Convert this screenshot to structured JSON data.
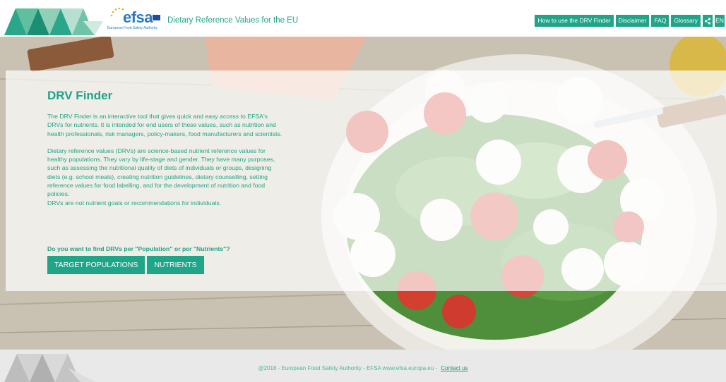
{
  "header": {
    "site_title": "Dietary Reference Values for the EU",
    "logo": {
      "name": "efsa",
      "tagline": "European Food Safety Authority"
    },
    "nav": [
      {
        "label": "How to use the DRV Finder"
      },
      {
        "label": "Disclaimer"
      },
      {
        "label": "FAQ"
      },
      {
        "label": "Glossary"
      }
    ],
    "share_icon": "share-icon",
    "language": "EN"
  },
  "main": {
    "title": "DRV Finder",
    "paragraph1": "The DRV Finder is an interactive tool that gives quick and easy access to EFSA's DRVs for nutrients. It is intended for end users of these values, such as nutrition and health professionals, risk managers, policy-makers, food manufacturers and scientists.",
    "paragraph2": "Dietary reference values (DRVs) are science-based nutrient reference values for healthy populations. They vary by life-stage and gender. They have many purposes, such as assessing the nutritional quality of diets of individuals or groups, designing diets (e.g. school meals), creating nutrition guidelines, dietary counselling, setting reference values for food labelling, and for the development of nutrition and food policies.",
    "note": "DRVs are not nutrient goals or recommendations for individuals.",
    "question": "Do you want to find DRVs per \"Population\" or per \"Nutrients\"?",
    "buttons": {
      "populations": "TARGET POPULATIONS",
      "nutrients": "NUTRIENTS"
    }
  },
  "footer": {
    "copyright": "@2018 - European Food Safety Authority - EFSA www.efsa.europa.eu -",
    "contact": "Contact us"
  },
  "colors": {
    "accent": "#1fa587",
    "brand_blue": "#2c7bbf",
    "footer_bg": "#e9e9e9"
  }
}
